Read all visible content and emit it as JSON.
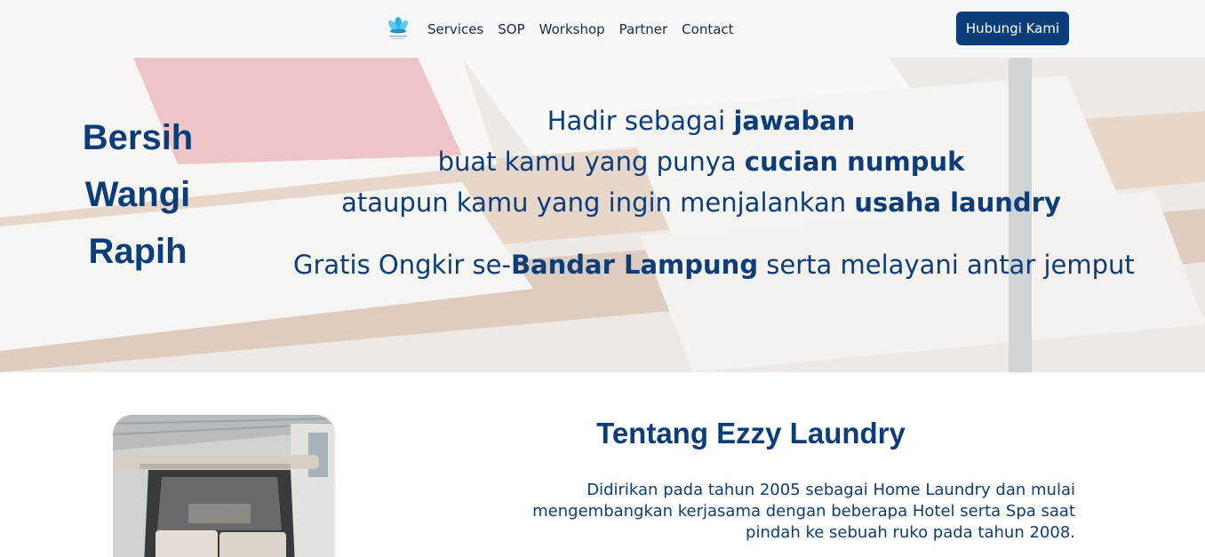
{
  "nav": {
    "logo_icon": "lotus-flower-logo",
    "links": [
      "Services",
      "SOP",
      "Workshop",
      "Partner",
      "Contact"
    ],
    "cta_label": "Hubungi Kami"
  },
  "hero": {
    "tagline": [
      "Bersih",
      "Wangi",
      "Rapih"
    ],
    "line1": {
      "pre": "Hadir sebagai ",
      "bold": "jawaban"
    },
    "line2": {
      "pre": "buat kamu yang punya ",
      "bold": "cucian numpuk"
    },
    "line3": {
      "pre": "ataupun kamu yang ingin menjalankan ",
      "bold": "usaha laundry"
    },
    "line4": {
      "pre": "Gratis Ongkir se-",
      "bold": "Bandar Lampung",
      "post": " serta melayani antar jemput"
    }
  },
  "about": {
    "title": "Tentang Ezzy Laundry",
    "description": "Didirikan pada tahun 2005 sebagai Home Laundry dan mulai mengembangkan kerjasama dengan beberapa Hotel serta Spa saat pindah ke sebuah ruko pada tahun 2008."
  },
  "colors": {
    "primary": "#0b3d7a",
    "navbar_bg": "#f6f7f9",
    "accent_logo": "#2bb3e6"
  }
}
